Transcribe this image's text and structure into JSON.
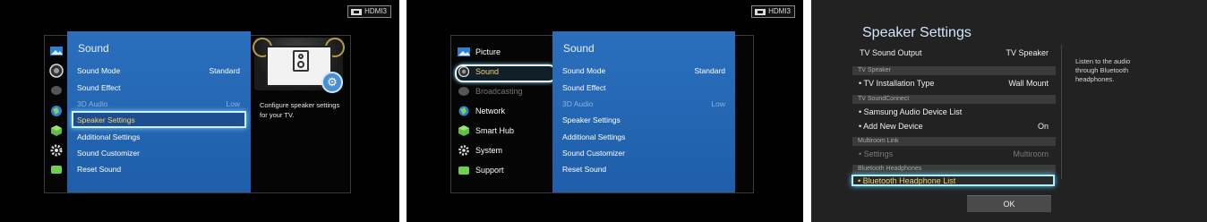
{
  "screen1": {
    "source": "HDMI3",
    "menu_title": "Sound",
    "items": [
      {
        "label": "Sound Mode",
        "value": "Standard",
        "disabled": false
      },
      {
        "label": "Sound Effect",
        "value": "",
        "disabled": false
      },
      {
        "label": "3D Audio",
        "value": "Low",
        "disabled": true
      },
      {
        "label": "Speaker Settings",
        "value": "",
        "disabled": false,
        "selected": true
      },
      {
        "label": "Additional Settings",
        "value": "",
        "disabled": false
      },
      {
        "label": "Sound Customizer",
        "value": "",
        "disabled": false
      },
      {
        "label": "Reset Sound",
        "value": "",
        "disabled": false
      }
    ],
    "description": "Configure speaker settings for your TV."
  },
  "screen2": {
    "source": "HDMI3",
    "sidebar": [
      {
        "label": "Picture",
        "icon": "picture-icon",
        "disabled": false
      },
      {
        "label": "Sound",
        "icon": "sound-icon",
        "disabled": false,
        "selected": true
      },
      {
        "label": "Broadcasting",
        "icon": "broadcasting-icon",
        "disabled": true
      },
      {
        "label": "Network",
        "icon": "network-icon",
        "disabled": false
      },
      {
        "label": "Smart Hub",
        "icon": "smart-hub-icon",
        "disabled": false
      },
      {
        "label": "System",
        "icon": "system-icon",
        "disabled": false
      },
      {
        "label": "Support",
        "icon": "support-icon",
        "disabled": false
      }
    ],
    "menu_title": "Sound",
    "items": [
      {
        "label": "Sound Mode",
        "value": "Standard",
        "disabled": false
      },
      {
        "label": "Sound Effect",
        "value": "",
        "disabled": false
      },
      {
        "label": "3D Audio",
        "value": "Low",
        "disabled": true
      },
      {
        "label": "Speaker Settings",
        "value": "",
        "disabled": false
      },
      {
        "label": "Additional Settings",
        "value": "",
        "disabled": false
      },
      {
        "label": "Sound Customizer",
        "value": "",
        "disabled": false
      },
      {
        "label": "Reset Sound",
        "value": "",
        "disabled": false
      }
    ]
  },
  "screen3": {
    "title": "Speaker Settings",
    "tv_sound_output_label": "TV Sound Output",
    "tv_sound_output_value": "TV Speaker",
    "section_tv_speaker": "TV Speaker",
    "installation_label": "• TV Installation Type",
    "installation_value": "Wall Mount",
    "section_soundconnect": "TV SoundConnect",
    "device_list_label": "• Samsung Audio Device List",
    "add_device_label": "• Add New Device",
    "add_device_value": "On",
    "section_multiroom": "Multiroom Link",
    "settings_label": "• Settings",
    "settings_value": "Multiroom",
    "section_bt": "Bluetooth Headphones",
    "bt_list_label": "• Bluetooth Headphone List",
    "help_text": "Listen to the audio through Bluetooth headphones.",
    "ok_label": "OK"
  },
  "colors": {
    "menu_blue": "#2a6fbd",
    "selection_glow": "#7fd4ff",
    "selected_text_yellow": "#f6d36b"
  }
}
